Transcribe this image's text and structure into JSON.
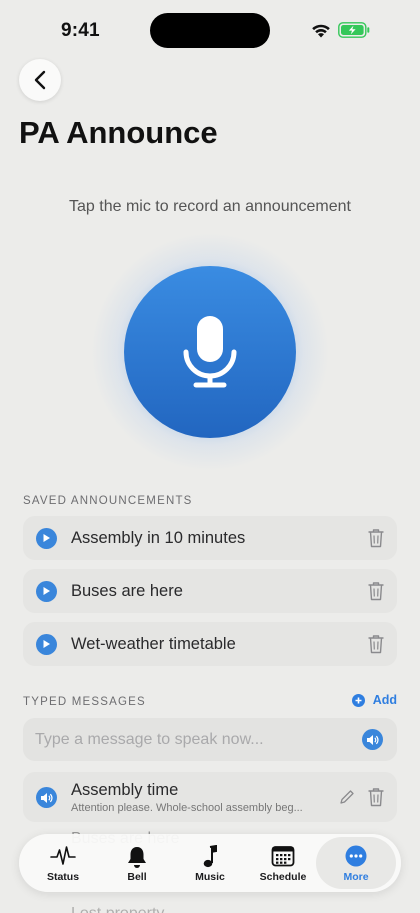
{
  "status_bar": {
    "time": "9:41"
  },
  "page": {
    "title": "PA Announce",
    "hint": "Tap the mic to record an announcement"
  },
  "saved": {
    "header": "SAVED ANNOUNCEMENTS",
    "items": [
      {
        "label": "Assembly in 10 minutes"
      },
      {
        "label": "Buses are here"
      },
      {
        "label": "Wet-weather timetable"
      }
    ]
  },
  "typed": {
    "header": "TYPED MESSAGES",
    "add_label": "Add",
    "input_placeholder": "Type a message to speak now...",
    "items": [
      {
        "title": "Assembly time",
        "subtitle": "Attention please. Whole-school assembly beg..."
      }
    ],
    "ghost_items": [
      "Buses are here",
      "Lost property"
    ]
  },
  "tabs": [
    {
      "label": "Status",
      "icon": "pulse-icon"
    },
    {
      "label": "Bell",
      "icon": "bell-icon"
    },
    {
      "label": "Music",
      "icon": "music-note-icon"
    },
    {
      "label": "Schedule",
      "icon": "calendar-icon"
    },
    {
      "label": "More",
      "icon": "more-icon",
      "active": true
    }
  ],
  "colors": {
    "accent": "#2f7ee0",
    "mic": "#2a74cf",
    "background": "#ececea"
  }
}
